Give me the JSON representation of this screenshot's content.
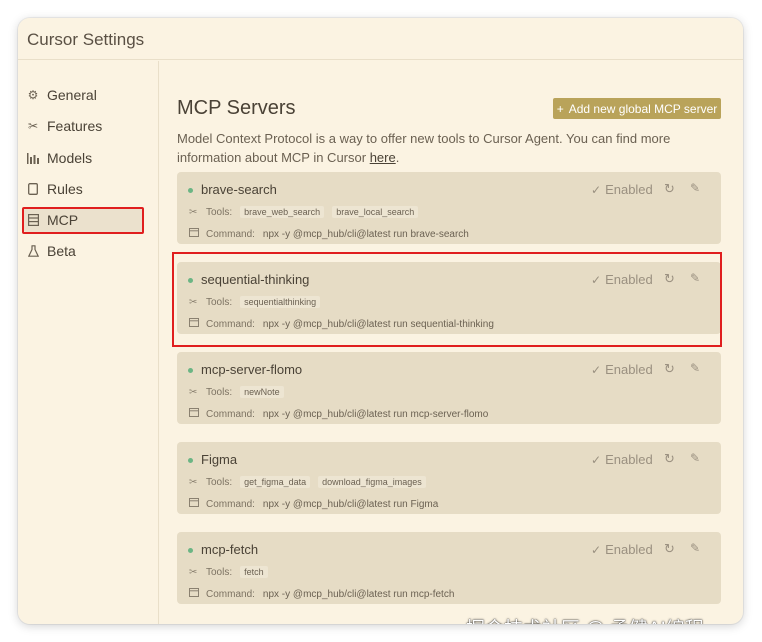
{
  "window": {
    "title": "Cursor Settings"
  },
  "sidebar": {
    "items": [
      {
        "label": "General",
        "icon": "gear-icon"
      },
      {
        "label": "Features",
        "icon": "tools-icon"
      },
      {
        "label": "Models",
        "icon": "chart-icon"
      },
      {
        "label": "Rules",
        "icon": "document-icon"
      },
      {
        "label": "MCP",
        "icon": "server-icon",
        "active": true
      },
      {
        "label": "Beta",
        "icon": "flask-icon"
      }
    ]
  },
  "main": {
    "heading": "MCP Servers",
    "add_button": "Add new global MCP server",
    "description": "Model Context Protocol is a way to offer new tools to Cursor Agent. You can find more information about MCP in Cursor ",
    "description_link": "here",
    "description_end": ".",
    "tools_label": "Tools:",
    "command_label": "Command:",
    "enabled_label": "Enabled",
    "servers": [
      {
        "name": "brave-search",
        "tools": [
          "brave_web_search",
          "brave_local_search"
        ],
        "command": "npx -y @mcp_hub/cli@latest run brave-search"
      },
      {
        "name": "sequential-thinking",
        "tools": [
          "sequentialthinking"
        ],
        "command": "npx -y @mcp_hub/cli@latest run sequential-thinking"
      },
      {
        "name": "mcp-server-flomo",
        "tools": [
          "newNote"
        ],
        "command": "npx -y @mcp_hub/cli@latest run mcp-server-flomo"
      },
      {
        "name": "Figma",
        "tools": [
          "get_figma_data",
          "download_figma_images"
        ],
        "command": "npx -y @mcp_hub/cli@latest run Figma"
      },
      {
        "name": "mcp-fetch",
        "tools": [
          "fetch"
        ],
        "command": "npx -y @mcp_hub/cli@latest run mcp-fetch"
      }
    ]
  },
  "watermark": "掘金技术社区 @ 孟健AI编程",
  "colors": {
    "accent": "#b9a35a",
    "highlight": "#e01e1e",
    "status_dot": "#6bb584",
    "card_bg": "#e6dcc5"
  }
}
